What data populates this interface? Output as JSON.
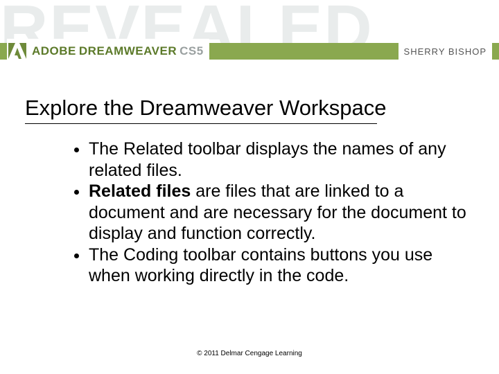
{
  "banner": {
    "bg_word": "REVEALED",
    "brand_adobe": "ADOBE",
    "brand_product": "DREAMWEAVER",
    "brand_version": "CS5",
    "author": "SHERRY BISHOP"
  },
  "slide": {
    "title": "Explore the Dreamweaver Workspace",
    "bullets": [
      {
        "pre": "The Related toolbar displays the names of any related files.",
        "bold": "",
        "post": ""
      },
      {
        "pre": "",
        "bold": "Related files",
        "post": " are files that are linked to a document and are necessary for the document to display and function correctly."
      },
      {
        "pre": "The Coding toolbar contains buttons you use when working directly in the code.",
        "bold": "",
        "post": ""
      }
    ]
  },
  "footer": {
    "copyright": "© 2011 Delmar Cengage Learning"
  }
}
